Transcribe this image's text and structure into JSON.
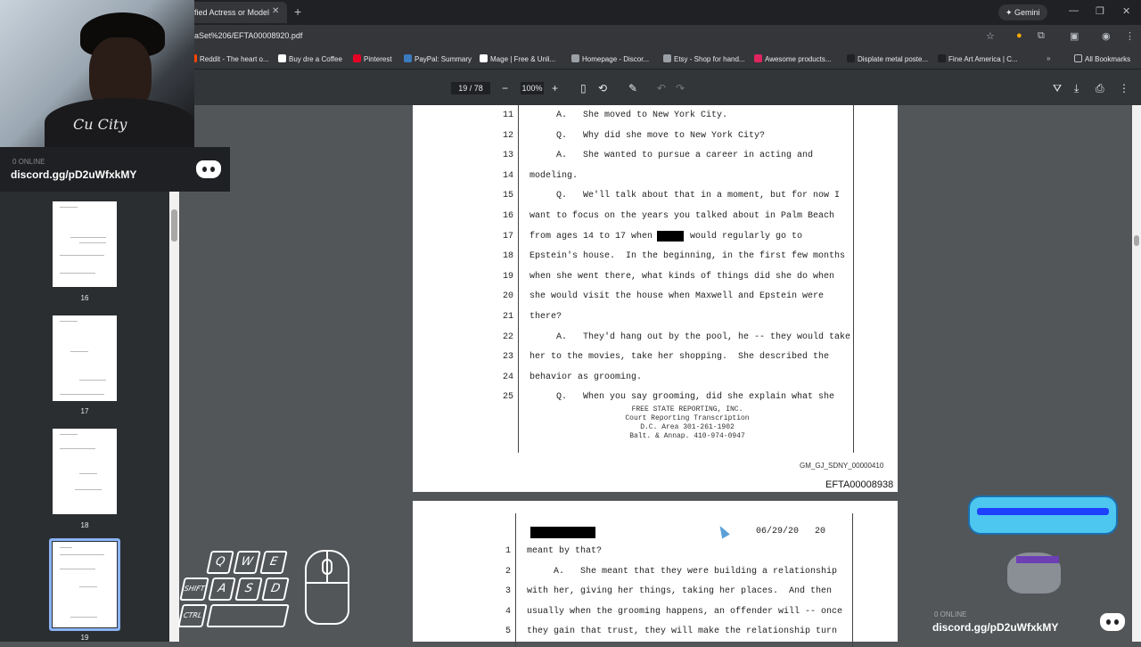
{
  "browser": {
    "tab_title": "fied Actress or Model",
    "new_tab": "+",
    "gemini_label": "Gemini",
    "url": "aSet%206/EFTA00008920.pdf",
    "bookmarks": [
      {
        "label": "Reddit - The heart o...",
        "color": "#ff4500"
      },
      {
        "label": "Buy dre a Coffee",
        "color": "#ffffff"
      },
      {
        "label": "Pinterest",
        "color": "#e60023"
      },
      {
        "label": "PayPal: Summary",
        "color": "#3b7bbf"
      },
      {
        "label": "Mage | Free & Unli...",
        "color": "#ffffff"
      },
      {
        "label": "Homepage - Discor...",
        "color": "#9aa0a6"
      },
      {
        "label": "Etsy - Shop for hand...",
        "color": "#9aa0a6"
      },
      {
        "label": "Awesome products...",
        "color": "#e0245e"
      },
      {
        "label": "Displate metal poste...",
        "color": "#202124"
      },
      {
        "label": "Fine Art America | C...",
        "color": "#202124"
      }
    ],
    "all_bookmarks": "All Bookmarks"
  },
  "pdf": {
    "page_current": "19",
    "page_total": "/ 78",
    "zoom": "100%",
    "thumbnails": [
      "16",
      "17",
      "18",
      "19"
    ],
    "page1": {
      "lines": [
        {
          "n": "11",
          "t": "     A.   She moved to New York City."
        },
        {
          "n": "12",
          "t": "     Q.   Why did she move to New York City?"
        },
        {
          "n": "13",
          "t": "     A.   She wanted to pursue a career in acting and"
        },
        {
          "n": "14",
          "t": "modeling."
        },
        {
          "n": "15",
          "t": "     Q.   We'll talk about that in a moment, but for now I"
        },
        {
          "n": "16",
          "t": "want to focus on the years you talked about in Palm Beach"
        },
        {
          "n": "17",
          "t": "from ages 14 to 17 when       would regularly go to"
        },
        {
          "n": "18",
          "t": "Epstein's house.  In the beginning, in the first few months"
        },
        {
          "n": "19",
          "t": "when she went there, what kinds of things did she do when"
        },
        {
          "n": "20",
          "t": "she would visit the house when Maxwell and Epstein were"
        },
        {
          "n": "21",
          "t": "there?"
        },
        {
          "n": "22",
          "t": "     A.   They'd hang out by the pool, he -- they would take"
        },
        {
          "n": "23",
          "t": "her to the movies, take her shopping.  She described the"
        },
        {
          "n": "24",
          "t": "behavior as grooming."
        },
        {
          "n": "25",
          "t": "     Q.   When you say grooming, did she explain what she"
        }
      ],
      "footer": [
        "FREE STATE REPORTING, INC.",
        "Court Reporting  Transcription",
        "D.C. Area 301-261-1902",
        "Balt. & Annap. 410-974-0947"
      ],
      "bates": "GM_GJ_SDNY_00000410",
      "efta": "EFTA00008938"
    },
    "page2": {
      "header_right": "06/29/20   20",
      "lines": [
        {
          "n": "1",
          "t": "meant by that?"
        },
        {
          "n": "2",
          "t": "     A.   She meant that they were building a relationship"
        },
        {
          "n": "3",
          "t": "with her, giving her things, taking her places.  And then"
        },
        {
          "n": "4",
          "t": "usually when the grooming happens, an offender will -- once"
        },
        {
          "n": "5",
          "t": "they gain that trust, they will make the relationship turn"
        }
      ]
    }
  },
  "overlay": {
    "shirt_text": "Cu City",
    "online1": "0 ONLINE",
    "discord1": "discord.gg/pD2uWfxkMY",
    "online2": "0 ONLINE",
    "discord2": "discord.gg/pD2uWfxkMY",
    "keys": [
      "Q",
      "W",
      "E",
      "SHIFT",
      "A",
      "S",
      "D",
      "CTRL"
    ]
  }
}
